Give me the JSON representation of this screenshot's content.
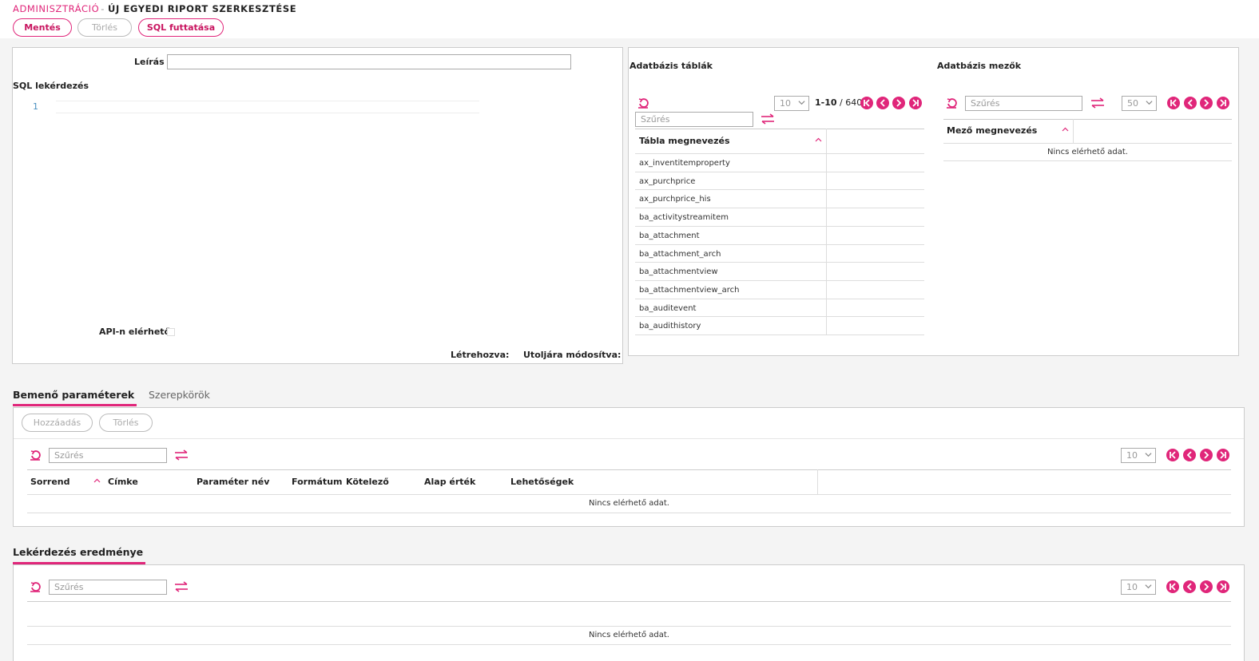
{
  "breadcrumb": {
    "section": "ADMINISZTRÁCIÓ",
    "separator": "-",
    "page": "ÚJ EGYEDI RIPORT SZERKESZTÉSE"
  },
  "toolbar": {
    "save_label": "Mentés",
    "delete_label": "Törlés",
    "run_sql_label": "SQL futtatása"
  },
  "editor": {
    "description_label": "Leírás",
    "description_value": "",
    "sql_label": "SQL lekérdezés",
    "line_number": "1",
    "api_label": "API-n elérhető",
    "created_label": "Létrehozva:",
    "modified_label": "Utoljára módosítva:"
  },
  "db_tables": {
    "title": "Adatbázis táblák",
    "page_size": "10",
    "range": "1-10",
    "total": "/ 640",
    "filter_placeholder": "Szűrés",
    "column_header": "Tábla megnevezés",
    "rows": [
      "ax_inventitemproperty",
      "ax_purchprice",
      "ax_purchprice_his",
      "ba_activitystreamitem",
      "ba_attachment",
      "ba_attachment_arch",
      "ba_attachmentview",
      "ba_attachmentview_arch",
      "ba_auditevent",
      "ba_audithistory"
    ]
  },
  "db_fields": {
    "title": "Adatbázis mezők",
    "filter_placeholder": "Szűrés",
    "page_size": "50",
    "column_header": "Mező megnevezés",
    "empty_text": "Nincs elérhető adat."
  },
  "tabs": [
    {
      "label": "Bemenő paraméterek",
      "active": true
    },
    {
      "label": "Szerepkörök",
      "active": false
    }
  ],
  "params": {
    "add_label": "Hozzáadás",
    "delete_label": "Törlés",
    "filter_placeholder": "Szűrés",
    "page_size": "10",
    "columns": [
      "Sorrend",
      "Címke",
      "Paraméter név",
      "Formátum",
      "Kötelező",
      "Alap érték",
      "Lehetőségek"
    ],
    "empty_text": "Nincs elérhető adat."
  },
  "results": {
    "title": "Lekérdezés eredménye",
    "filter_placeholder": "Szűrés",
    "page_size": "10",
    "empty_text": "Nincs elérhető adat."
  },
  "colors": {
    "accent": "#e0267a",
    "border": "#cccccc",
    "background": "#f4f4f4"
  }
}
